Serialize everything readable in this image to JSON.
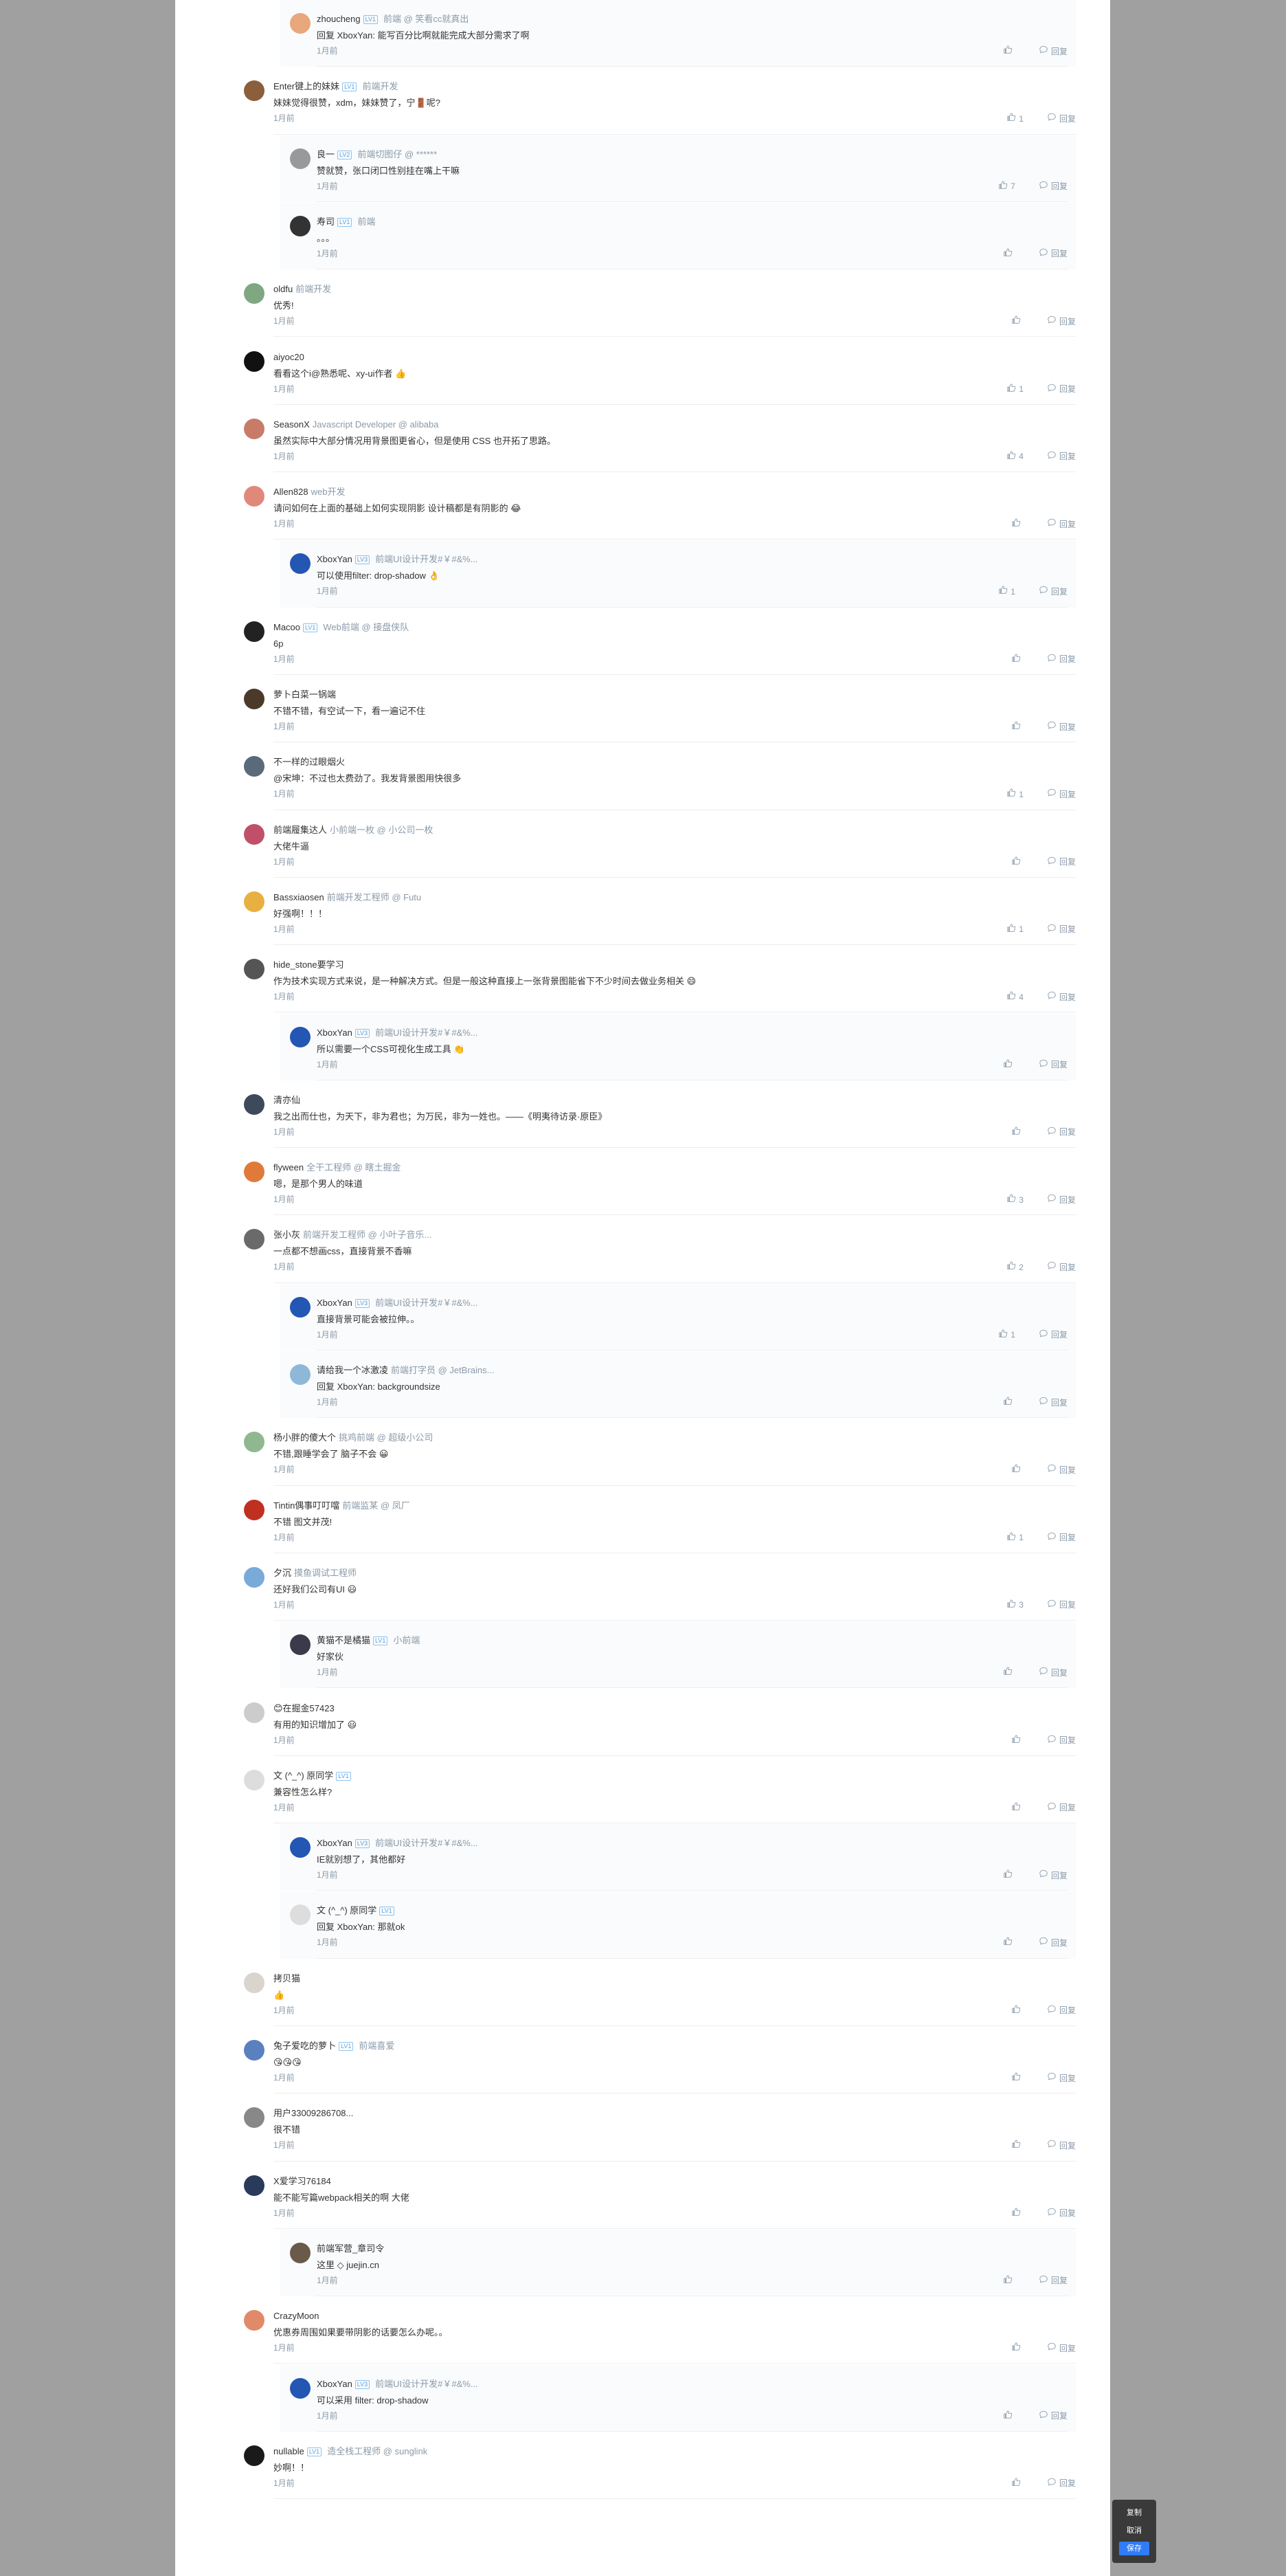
{
  "labels": {
    "time": "1月前",
    "reply": "回复"
  },
  "colors": {
    "link": "#406599",
    "accent": "#2f7cf6",
    "muted": "#8a9aa9"
  },
  "comments": [
    {
      "level": 2,
      "name": "zhoucheng",
      "lv": "LV1",
      "title": "前端 @ 笑看cc就真出",
      "content": "回复 XboxYan: 能写百分比啊就能完成大部分需求了啊",
      "reply_to": "XboxYan",
      "likes": "",
      "color": "#e8a87c"
    },
    {
      "level": 1,
      "name": "Enter键上的妹妹",
      "lv": "LV1",
      "title": "前端开发",
      "content": "妹妹觉得很赞，xdm，妹妹赞了，宁🚪呢?",
      "likes": "1",
      "color": "#8b5e3c"
    },
    {
      "level": 2,
      "name": "良一",
      "lv": "LV2",
      "title": "前端切图仔 @ ******",
      "content": "赞就赞，张口闭口性别挂在嘴上干嘛",
      "likes": "7",
      "color": "#999999"
    },
    {
      "level": 2,
      "name": "寿司",
      "lv": "LV1",
      "title": "前端",
      "content": "。。。",
      "likes": "",
      "color": "#333333"
    },
    {
      "level": 1,
      "name": "oldfu",
      "lv": "",
      "title": "前端开发",
      "content": "优秀!",
      "likes": "",
      "color": "#7fa882"
    },
    {
      "level": 1,
      "name": "aiyoc20",
      "lv": "",
      "title": "",
      "content": "看看这个i@熟悉呢、xy-ui作者 👍",
      "likes": "1",
      "color": "#111111"
    },
    {
      "level": 1,
      "name": "SeasonX",
      "lv": "",
      "title": "Javascript Developer @ alibaba",
      "content": "虽然实际中大部分情况用背景图更省心，但是使用 CSS 也开拓了思路。",
      "likes": "4",
      "color": "#c97b6a"
    },
    {
      "level": 1,
      "name": "Allen828",
      "lv": "",
      "title": "web开发",
      "content": "请问如何在上面的基础上如何实现阴影 设计稿都是有阴影的 😂",
      "likes": "",
      "color": "#e0887a"
    },
    {
      "level": 2,
      "name": "XboxYan",
      "lv": "LV3",
      "title": "前端UI设计开发#￥#&%...",
      "content": "可以使用filter: drop-shadow 👌",
      "likes": "1",
      "color": "#2456b3"
    },
    {
      "level": 1,
      "name": "Macoo",
      "lv": "LV1",
      "title": "Web前端 @ 接盘侠队",
      "content": "6p",
      "likes": "",
      "color": "#222222"
    },
    {
      "level": 1,
      "name": "萝卜白菜一锅端",
      "lv": "",
      "title": "",
      "content": "不错不错，有空试一下，看一遍记不住",
      "likes": "",
      "color": "#4b3a2a"
    },
    {
      "level": 1,
      "name": "不一样的过眼烟火",
      "lv": "",
      "title": "",
      "content": "@宋坤：不过也太费劲了。我发背景图用快很多",
      "likes": "1",
      "color": "#5a6a7a"
    },
    {
      "level": 1,
      "name": "前端履集达人",
      "lv": "",
      "title": "小前端一枚 @ 小公司一枚",
      "content": "大佬牛逼",
      "likes": "",
      "color": "#c0506a"
    },
    {
      "level": 1,
      "name": "Bassxiaosen",
      "lv": "",
      "title": "前端开发工程师 @ Futu",
      "content": "好强啊！！！",
      "likes": "1",
      "color": "#e8b040"
    },
    {
      "level": 1,
      "name": "hide_stone要学习",
      "lv": "",
      "title": "",
      "content": "作为技术实现方式来说，是一种解决方式。但是一般这种直接上一张背景图能省下不少时间去做业务相关 😄",
      "likes": "4",
      "color": "#555555"
    },
    {
      "level": 2,
      "name": "XboxYan",
      "lv": "LV3",
      "title": "前端UI设计开发#￥#&%...",
      "content": "所以需要一个CSS可视化生成工具 👏",
      "likes": "",
      "color": "#2456b3"
    },
    {
      "level": 1,
      "name": "清亦仙",
      "lv": "",
      "title": "",
      "content": "我之出而仕也，为天下，非为君也；为万民，非为一姓也。——《明夷待访录·原臣》",
      "likes": "",
      "color": "#3d4a5c"
    },
    {
      "level": 1,
      "name": "flyween",
      "lv": "",
      "title": "全干工程师 @ 瞎土掘金",
      "content": "嗯，是那个男人的味道",
      "likes": "3",
      "color": "#e07a3a"
    },
    {
      "level": 1,
      "name": "张小灰",
      "lv": "",
      "title": "前端开发工程师 @ 小叶子音乐...",
      "content": "一点都不想画css，直接背景不香嘛",
      "likes": "2",
      "color": "#6a6a6a"
    },
    {
      "level": 2,
      "name": "XboxYan",
      "lv": "LV3",
      "title": "前端UI设计开发#￥#&%...",
      "content": "直接背景可能会被拉伸。。",
      "likes": "1",
      "color": "#2456b3"
    },
    {
      "level": 2,
      "name": "请给我一个冰激凌",
      "lv": "",
      "title": "前端打字员 @ JetBrains...",
      "content": "回复 XboxYan: backgroundsize",
      "reply_to": "XboxYan",
      "likes": "",
      "color": "#8fb8d8"
    },
    {
      "level": 1,
      "name": "杨小胖的傻大个",
      "lv": "",
      "title": "挑鸡前端 @ 超级小公司",
      "content": "不错,跟睡学会了 脑子不会 😀",
      "likes": "",
      "color": "#8fb890"
    },
    {
      "level": 1,
      "name": "Tintin偶事叮叮噹",
      "lv": "",
      "title": "前端监某 @ 凤厂",
      "content": "不错 图文并茂!",
      "likes": "1",
      "color": "#c03020"
    },
    {
      "level": 1,
      "name": "夕沉",
      "lv": "",
      "title": "摸鱼调试工程师",
      "content": "还好我们公司有UI 😃",
      "likes": "3",
      "color": "#7aaad8"
    },
    {
      "level": 2,
      "name": "黄猫不是橘猫",
      "lv": "LV1",
      "title": "小前端",
      "content": "好家伙",
      "likes": "",
      "color": "#3a3a4a"
    },
    {
      "level": 1,
      "name": "😊在掘金57423",
      "lv": "",
      "title": "",
      "content": "有用的知识增加了 😃",
      "likes": "",
      "color": "#cccccc"
    },
    {
      "level": 1,
      "name": "文 (^_^) 原同学",
      "lv": "LV1",
      "title": "",
      "content": "兼容性怎么样?",
      "likes": "",
      "color": "#dddddd"
    },
    {
      "level": 2,
      "name": "XboxYan",
      "lv": "LV3",
      "title": "前端UI设计开发#￥#&%...",
      "content": "IE就别想了，其他都好",
      "likes": "",
      "color": "#2456b3"
    },
    {
      "level": 2,
      "name": "文 (^_^) 原同学",
      "lv": "LV1",
      "title": "",
      "content": "回复 XboxYan: 那就ok",
      "reply_to": "XboxYan",
      "likes": "",
      "color": "#dddddd"
    },
    {
      "level": 1,
      "name": "拷贝猫",
      "lv": "",
      "title": "",
      "content": "👍",
      "likes": "",
      "color": "#d9d4cc"
    },
    {
      "level": 1,
      "name": "兔子爱吃的萝卜",
      "lv": "LV1",
      "title": "前端喜爱",
      "content": "😘😘😘",
      "likes": "",
      "color": "#5a80c0"
    },
    {
      "level": 1,
      "name": "用户33009286708...",
      "lv": "",
      "title": "",
      "content": "很不错",
      "likes": "",
      "color": "#888888"
    },
    {
      "level": 1,
      "name": "X爱学习76184",
      "lv": "",
      "title": "",
      "content": "能不能写篇webpack相关的啊 大佬",
      "likes": "",
      "color": "#2a3a5a"
    },
    {
      "level": 2,
      "name": "前端军营_章司令",
      "lv": "",
      "title": "",
      "content": "这里 ◇ juejin.cn",
      "likes": "",
      "color": "#6a5a4a"
    },
    {
      "level": 1,
      "name": "CrazyMoon",
      "lv": "",
      "title": "",
      "content": "优惠券周围如果要带阴影的话要怎么办呢。。",
      "likes": "",
      "color": "#e08a6a"
    },
    {
      "level": 2,
      "name": "XboxYan",
      "lv": "LV3",
      "title": "前端UI设计开发#￥#&%...",
      "content": "可以采用 filter: drop-shadow",
      "likes": "",
      "color": "#2456b3"
    },
    {
      "level": 1,
      "name": "nullable",
      "lv": "LV1",
      "title": "造全栈工程师 @ sunglink",
      "content": "妙啊！！",
      "likes": "",
      "color": "#1a1a1a"
    }
  ],
  "float_menu": {
    "copy": "复制",
    "cancel": "取消",
    "save": "保存"
  }
}
